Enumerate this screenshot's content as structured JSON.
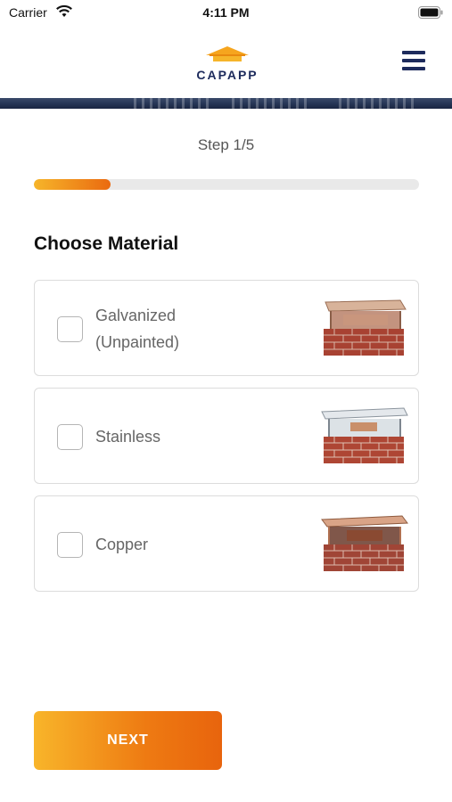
{
  "status_bar": {
    "carrier": "Carrier",
    "time": "4:11 PM"
  },
  "header": {
    "logo_text": "CAPAPP",
    "menu_icon": "hamburger-menu-icon"
  },
  "step": {
    "label": "Step 1/5",
    "progress": 0.2
  },
  "section": {
    "title": "Choose Material"
  },
  "options": [
    {
      "label_line1": "Galvanized",
      "label_line2": "(Unpainted)",
      "checked": false,
      "image": "galvanized-chimney-cap-image"
    },
    {
      "label_line1": "Stainless",
      "label_line2": "",
      "checked": false,
      "image": "stainless-chimney-cap-image"
    },
    {
      "label_line1": "Copper",
      "label_line2": "",
      "checked": false,
      "image": "copper-chimney-cap-image"
    }
  ],
  "actions": {
    "next_label": "NEXT"
  },
  "colors": {
    "brand_navy": "#1d2b5c",
    "accent_start": "#f6b52a",
    "accent_end": "#ea6a10"
  }
}
